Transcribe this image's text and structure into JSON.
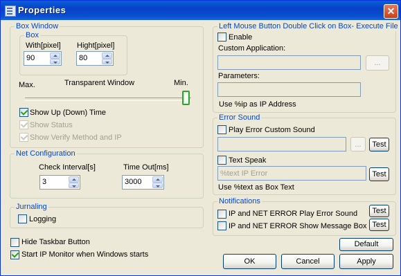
{
  "window": {
    "title": "Properties",
    "close_glyph": "✕"
  },
  "box_window": {
    "legend": "Box Window",
    "box_legend": "Box",
    "width_label": "With[pixel]",
    "width_value": "90",
    "height_label": "Hight[pixel]",
    "height_value": "80",
    "slider_max_label": "Max.",
    "slider_title": "Transparent Window",
    "slider_min_label": "Min.",
    "transparency_level": 1.0,
    "show_up_down_time": {
      "label": "Show Up (Down) Time",
      "checked": true
    },
    "show_status": {
      "label": "Show Status",
      "checked": true,
      "disabled": true
    },
    "show_verify": {
      "label": "Show Verify Method and IP",
      "checked": true,
      "disabled": true
    }
  },
  "net_config": {
    "legend": "Net Configuration",
    "check_interval_label": "Check Interval[s]",
    "check_interval_value": "3",
    "timeout_label": "Time Out[ms]",
    "timeout_value": "3000"
  },
  "journaling": {
    "legend": "Jurnaling",
    "logging": {
      "label": "Logging",
      "checked": false
    }
  },
  "hide_taskbar": {
    "label": "Hide Taskbar Button",
    "checked": false
  },
  "start_ip_monitor": {
    "label": "Start IP Monitor when Windows starts",
    "checked": true
  },
  "double_click": {
    "legend": "Left Mouse Button Double Click on Box- Execute File",
    "enable": {
      "label": "Enable",
      "checked": false
    },
    "custom_app_label": "Custom Application:",
    "custom_app_value": "",
    "browse_label": "...",
    "parameters_label": "Parameters:",
    "parameters_value": "",
    "hint": "Use %ip as IP Address"
  },
  "error_sound": {
    "legend": "Error Sound",
    "play_custom": {
      "label": "Play Error Custom Sound",
      "checked": false
    },
    "sound_file_value": "",
    "browse_label": "...",
    "test_label": "Test",
    "text_speak": {
      "label": "Text Speak",
      "checked": false
    },
    "speak_placeholder": "%text IP Error",
    "hint": "Use %text as Box Text"
  },
  "notifications": {
    "legend": "Notifications",
    "play_sound": {
      "label": "IP and NET ERROR Play Error Sound",
      "checked": false
    },
    "show_box": {
      "label": "IP and NET ERROR Show Message Box",
      "checked": false
    },
    "test_label": "Test"
  },
  "buttons": {
    "default": "Default",
    "ok": "OK",
    "cancel": "Cancel",
    "apply": "Apply"
  }
}
